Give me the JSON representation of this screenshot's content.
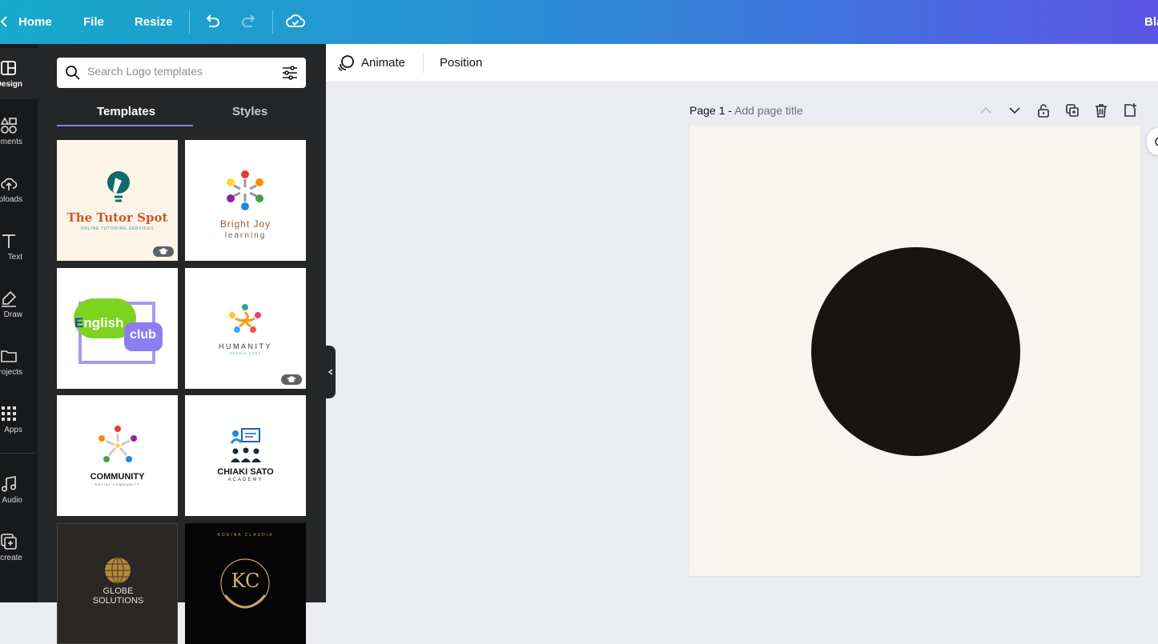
{
  "topbar": {
    "home": "Home",
    "file": "File",
    "resize": "Resize",
    "user_partial": "Bla"
  },
  "rail": [
    {
      "label": "Design",
      "icon": "layout-icon"
    },
    {
      "label": "ements",
      "icon": "shapes-icon"
    },
    {
      "label": "ploads",
      "icon": "cloud-upload-icon"
    },
    {
      "label": "Text",
      "icon": "text-icon"
    },
    {
      "label": "Draw",
      "icon": "pen-icon"
    },
    {
      "label": "rojects",
      "icon": "folder-icon"
    },
    {
      "label": "Apps",
      "icon": "grid-icon"
    },
    {
      "label": "Audio",
      "icon": "music-icon"
    },
    {
      "label": "k create",
      "icon": "bulk-create-icon"
    }
  ],
  "search": {
    "placeholder": "Search Logo templates"
  },
  "tabs": {
    "templates": "Templates",
    "styles": "Styles"
  },
  "templates": [
    {
      "title": "The Tutor Spot",
      "subtitle": "ONLINE TUTORING SERVICES"
    },
    {
      "title": "Bright Joy",
      "subtitle": "learning"
    },
    {
      "title": "nglish",
      "title_initial": "E",
      "subtitle": "club"
    },
    {
      "title": "HUMANITY",
      "subtitle": "PEOPLE CARE"
    },
    {
      "title": "COMMUNITY",
      "subtitle": "SOCIAL COMMUNITY"
    },
    {
      "title": "CHIAKI SATO",
      "subtitle": "ACADEMY"
    },
    {
      "title": "GLOBE",
      "subtitle": "SOLUTIONS"
    },
    {
      "title": "KC",
      "subtitle": "KORINA CLAUDIA"
    }
  ],
  "toolbar": {
    "animate": "Animate",
    "position": "Position"
  },
  "page": {
    "label": "Page 1 -",
    "title_placeholder": "Add page title"
  },
  "colors": {
    "accent": "#8b7cf6",
    "canvas": "#f8f5f0",
    "shape": "#161511"
  }
}
